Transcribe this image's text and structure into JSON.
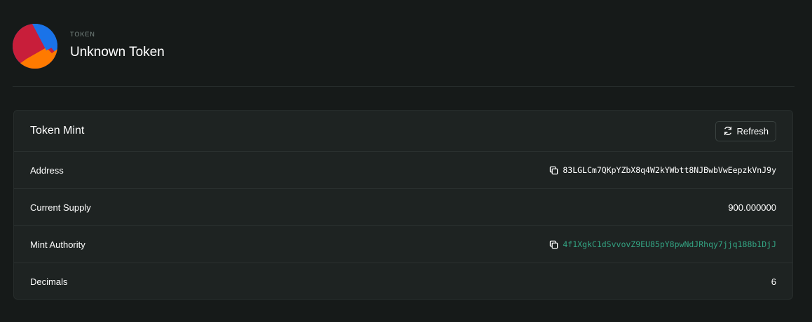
{
  "header": {
    "eyebrow": "TOKEN",
    "title": "Unknown Token",
    "avatar_icon": "token-avatar-icon"
  },
  "card": {
    "title": "Token Mint",
    "refresh_label": "Refresh",
    "refresh_icon": "refresh-icon",
    "rows": [
      {
        "label": "Address",
        "value": "83LGLCm7QKpYZbX8q4W2kYWbtt8NJBwbVwEepzkVnJ9y",
        "copyable": true,
        "link": false
      },
      {
        "label": "Current Supply",
        "value": "900.000000",
        "copyable": false,
        "link": false
      },
      {
        "label": "Mint Authority",
        "value": "4f1XgkC1dSvvovZ9EU85pY8pwNdJRhqy7jjq188b1DjJ",
        "copyable": true,
        "link": true
      },
      {
        "label": "Decimals",
        "value": "6",
        "copyable": false,
        "link": false
      }
    ]
  },
  "colors": {
    "background": "#161a19",
    "card": "#1e2322",
    "link": "#33a382"
  }
}
